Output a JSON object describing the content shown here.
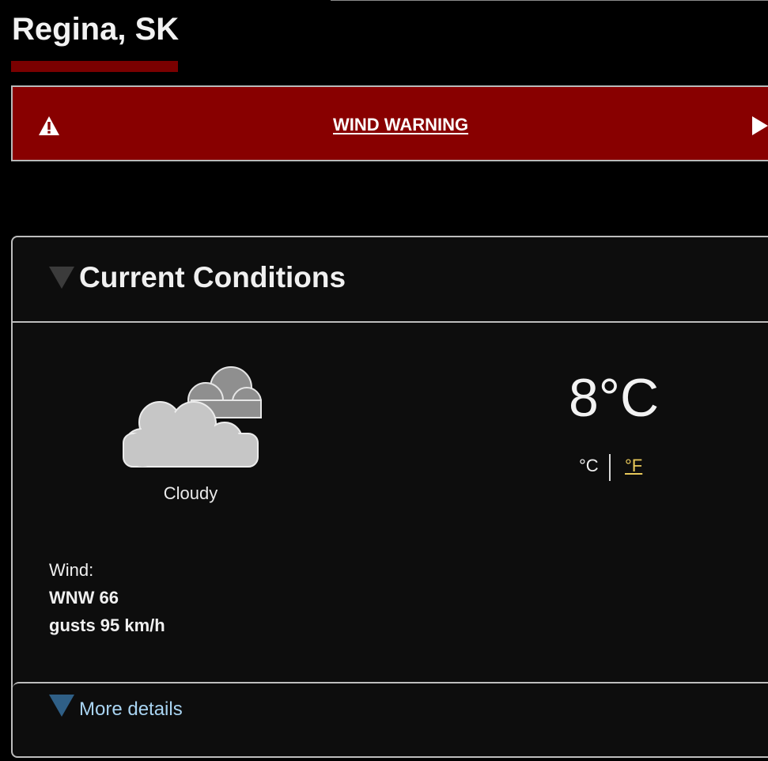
{
  "header": {
    "city": "Regina, SK"
  },
  "alert": {
    "label": "WIND WARNING",
    "icon": "warning-triangle-icon",
    "action_icon": "play-arrow-icon",
    "color": "#880000"
  },
  "current_conditions": {
    "title": "Current Conditions",
    "icon": "cloudy-icon",
    "condition": "Cloudy",
    "temperature": "8°C",
    "units": {
      "celsius": "°C",
      "fahrenheit": "°F"
    },
    "wind": {
      "label": "Wind:",
      "direction_speed": "WNW 66",
      "gusts": "gusts 95 km/h"
    },
    "more_details": "More details"
  },
  "colors": {
    "background": "#000000",
    "panel": "#0d0d0d",
    "accent_red": "#7a0000",
    "link_yellow": "#e8c85a",
    "link_blue": "#a9d4f2"
  }
}
